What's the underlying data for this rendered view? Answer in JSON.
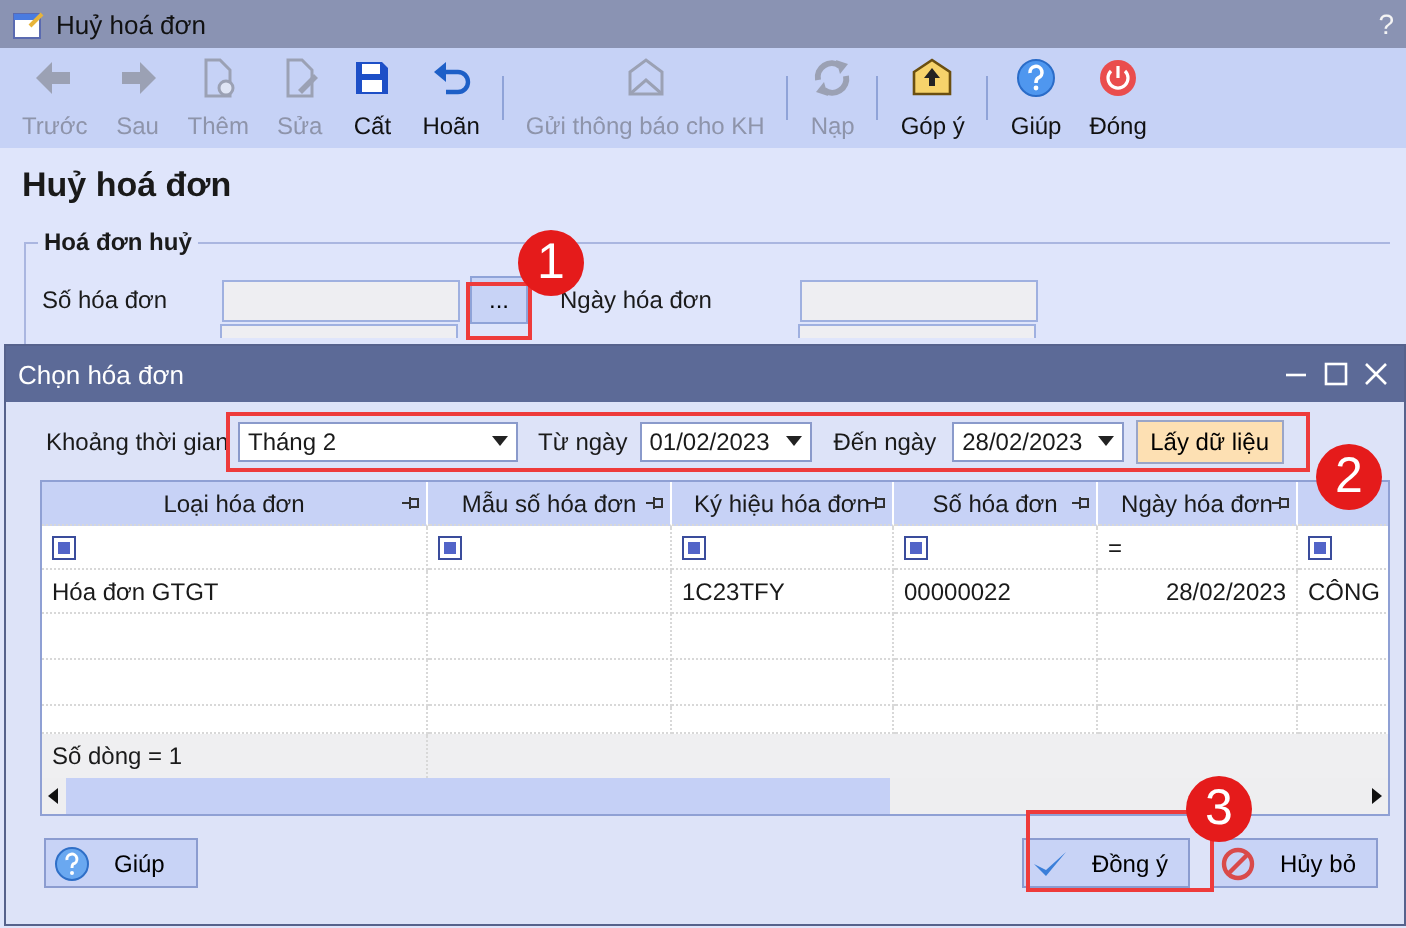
{
  "window": {
    "title": "Huỷ hoá đơn",
    "help_glyph": "?"
  },
  "toolbar": [
    {
      "label": "Trước",
      "disabled": true,
      "separator_after": false
    },
    {
      "label": "Sau",
      "disabled": true,
      "separator_after": false
    },
    {
      "label": "Thêm",
      "disabled": true,
      "separator_after": false
    },
    {
      "label": "Sửa",
      "disabled": true,
      "separator_after": false
    },
    {
      "label": "Cất",
      "disabled": false,
      "separator_after": false
    },
    {
      "label": "Hoãn",
      "disabled": false,
      "separator_after": true
    },
    {
      "label": "Gửi thông báo cho KH",
      "disabled": true,
      "separator_after": true
    },
    {
      "label": "Nạp",
      "disabled": true,
      "separator_after": true
    },
    {
      "label": "Góp ý",
      "disabled": false,
      "separator_after": true
    },
    {
      "label": "Giúp",
      "disabled": false,
      "separator_after": false
    },
    {
      "label": "Đóng",
      "disabled": false,
      "separator_after": false
    }
  ],
  "page_heading": "Huỷ hoá đơn",
  "invoice_group": {
    "title": "Hoá đơn huỷ",
    "number_label": "Số hóa đơn",
    "browse_button": "...",
    "date_label": "Ngày hóa đơn"
  },
  "dialog": {
    "title": "Chọn hóa đơn",
    "period_label": "Khoảng thời gian",
    "period": "Tháng 2",
    "from_label": "Từ ngày",
    "from": "01/02/2023",
    "to_label": "Đến ngày",
    "to": "28/02/2023",
    "fetch_button": "Lấy dữ liệu",
    "grid": {
      "columns": [
        "Loại hóa đơn",
        "Mẫu số hóa đơn",
        "Ký hiệu hóa đơn",
        "Số hóa đơn",
        "Ngày hóa đơn"
      ],
      "filters": [
        {
          "kind": "checkbox",
          "checked": true
        },
        {
          "kind": "checkbox",
          "checked": true
        },
        {
          "kind": "checkbox",
          "checked": true
        },
        {
          "kind": "checkbox",
          "checked": true
        },
        {
          "kind": "operator",
          "text": "="
        },
        {
          "kind": "checkbox",
          "checked": true
        }
      ],
      "rows": [
        {
          "cells": [
            "Hóa đơn GTGT",
            null,
            "1C23TFY",
            "00000022",
            "28/02/2023",
            "CÔNG"
          ]
        }
      ],
      "footer": "Số dòng = 1"
    },
    "buttons": [
      {
        "label": "Giúp",
        "kind": "help"
      },
      {
        "label": "Đồng ý",
        "kind": "ok"
      },
      {
        "label": "Hủy bỏ",
        "kind": "cancel"
      }
    ]
  },
  "annotations": [
    {
      "number": "1"
    },
    {
      "number": "2"
    },
    {
      "number": "3"
    }
  ]
}
